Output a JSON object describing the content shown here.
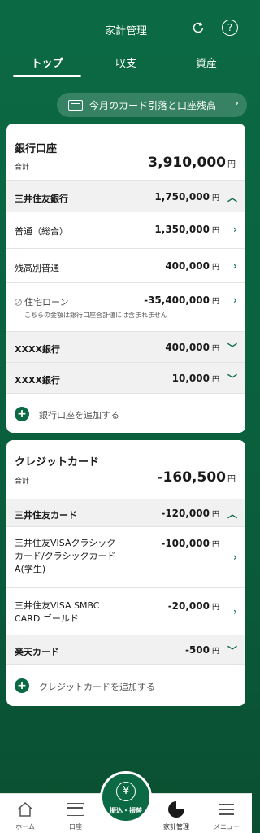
{
  "header": {
    "title": "家計管理",
    "help_label": "?",
    "tabs": [
      {
        "label": "トップ",
        "active": true
      },
      {
        "label": "収支",
        "active": false
      },
      {
        "label": "資産",
        "active": false
      }
    ]
  },
  "pill": {
    "label": "今月のカード引落と口座残高"
  },
  "bank": {
    "title": "銀行口座",
    "total_label": "合計",
    "total_value": "3,910,000",
    "yen": "円",
    "group1": {
      "name": "三井住友銀行",
      "value": "1,750,000"
    },
    "items": [
      {
        "label": "普通（総合）",
        "value": "1,350,000"
      },
      {
        "label": "残高別普通",
        "value": "400,000"
      },
      {
        "label": "住宅ローン",
        "value": "-35,400,000",
        "note": "こちらの金額は銀行口座合計値には含まれません"
      }
    ],
    "group2": {
      "name": "XXXX銀行",
      "value": "400,000"
    },
    "group3": {
      "name": "XXXX銀行",
      "value": "10,000"
    },
    "add_label": "銀行口座を追加する"
  },
  "credit": {
    "title": "クレジットカード",
    "total_label": "合計",
    "total_value": "-160,500",
    "yen": "円",
    "group1": {
      "name": "三井住友カード",
      "value": "-120,000"
    },
    "items": [
      {
        "label_lines": [
          "三井住友VISAクラシック",
          "カード/クラシックカード",
          "A(学生)"
        ],
        "value": "-100,000"
      },
      {
        "label_lines": [
          "三井住友VISA SMBC",
          "CARD ゴールド"
        ],
        "value": "-20,000"
      }
    ],
    "group2": {
      "name": "楽天カード",
      "value": "-500"
    },
    "add_label": "クレジットカードを追加する"
  },
  "nav": {
    "home": "ホーム",
    "account": "口座",
    "transfer": "振込・振替",
    "kakei": "家計管理",
    "menu": "メニュー"
  },
  "colors": {
    "brand": "#0b6a44"
  }
}
